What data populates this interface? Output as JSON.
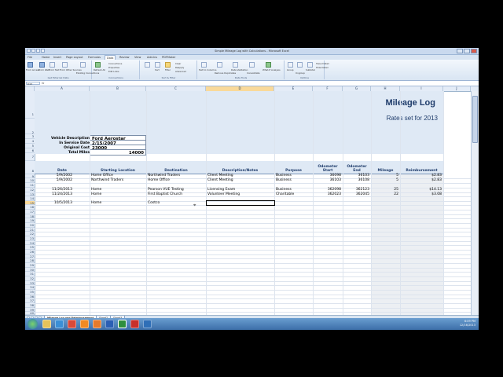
{
  "window": {
    "title": "Simple Mileage Log with Calculations - Microsoft Excel"
  },
  "ribbon": {
    "tabs": [
      "File",
      "Home",
      "Insert",
      "Page Layout",
      "Formulas",
      "Data",
      "Review",
      "View",
      "Add-Ins",
      "PDFMaker"
    ],
    "active_tab": "Data",
    "groups": [
      "Get External Data",
      "Connections",
      "Sort & Filter",
      "Data Tools",
      "Outline"
    ],
    "buttons": [
      "From Access",
      "From Web",
      "From Text",
      "From Other Sources",
      "Existing Connections",
      "Refresh All",
      "Connections",
      "Properties",
      "Edit Links",
      "Sort",
      "Filter",
      "Clear",
      "Reapply",
      "Advanced",
      "Text to Columns",
      "Remove Duplicates",
      "Data Validation",
      "Consolidate",
      "What-If Analysis",
      "Group",
      "Ungroup",
      "Subtotal",
      "Show Detail",
      "Hide Detail"
    ]
  },
  "formula_bar": {
    "name_box": "D15",
    "fx": "fx",
    "value": ""
  },
  "columns": [
    "A",
    "B",
    "C",
    "D",
    "E",
    "F",
    "G",
    "H",
    "I",
    "J"
  ],
  "selected_column": "D",
  "rows": [
    "1",
    "2",
    "3",
    "4",
    "5",
    "6",
    "7",
    "8",
    "9",
    "10",
    "11",
    "12",
    "13",
    "14",
    "15",
    "16",
    "17",
    "18",
    "19",
    "20",
    "21",
    "22",
    "23",
    "24",
    "25",
    "26",
    "27",
    "28",
    "29",
    "30",
    "31",
    "32",
    "33",
    "34",
    "35",
    "36",
    "37",
    "38",
    "39",
    "40"
  ],
  "selected_row": "15",
  "sheet": {
    "title": "Mileage Log",
    "subtitle": "Rates set for 2013",
    "info": [
      {
        "label": "Vehicle Description",
        "value": "Ford Aerostar"
      },
      {
        "label": "In Service Date",
        "value": "2/15/2007"
      },
      {
        "label": "Original Cost",
        "value": "23000"
      },
      {
        "label": "Total Miles",
        "value": "14000"
      }
    ],
    "headers": [
      "Date",
      "Starting Location",
      "Destination",
      "Description/Notes",
      "Purpose",
      "Odometer Start",
      "Odometer End",
      "Mileage",
      "Reimbursement"
    ],
    "data_rows": [
      {
        "row": "9",
        "cells": [
          "5/9/2002",
          "Home Office",
          "Northwind Traders",
          "Client Meeting",
          "Business",
          "36098",
          "36103",
          "5",
          "$2.83"
        ]
      },
      {
        "row": "10",
        "cells": [
          "5/9/2002",
          "Northwind Traders",
          "Home Office",
          "Client Meeting",
          "Business",
          "36103",
          "36108",
          "5",
          "$2.83"
        ]
      },
      {
        "row": "12",
        "cells": [
          "11/26/2013",
          "Home",
          "Pearson VUE Testing",
          "Licensing Exam",
          "Business",
          "362098",
          "362123",
          "25",
          "$14.13"
        ]
      },
      {
        "row": "13",
        "cells": [
          "11/24/2013",
          "Home",
          "First Baptist Church",
          "Volunteer Meeting",
          "Charitable",
          "362023",
          "362045",
          "22",
          "$3.08"
        ]
      },
      {
        "row": "15",
        "cells": [
          "10/5/2013",
          "Home",
          "Costco",
          "",
          "",
          "",
          "",
          "",
          ""
        ]
      }
    ]
  },
  "sheet_tabs": [
    "Mileage Log and Reimbursement",
    "Sheet2",
    "Sheet3"
  ],
  "status": {
    "text": "Ready",
    "zoom": "100%"
  },
  "taskbar": {
    "icons": [
      "explorer",
      "ie",
      "chrome",
      "media",
      "firefox",
      "word",
      "excel",
      "acrobat",
      "outlook"
    ],
    "time": "6:09 PM",
    "date": "12/16/2013"
  }
}
